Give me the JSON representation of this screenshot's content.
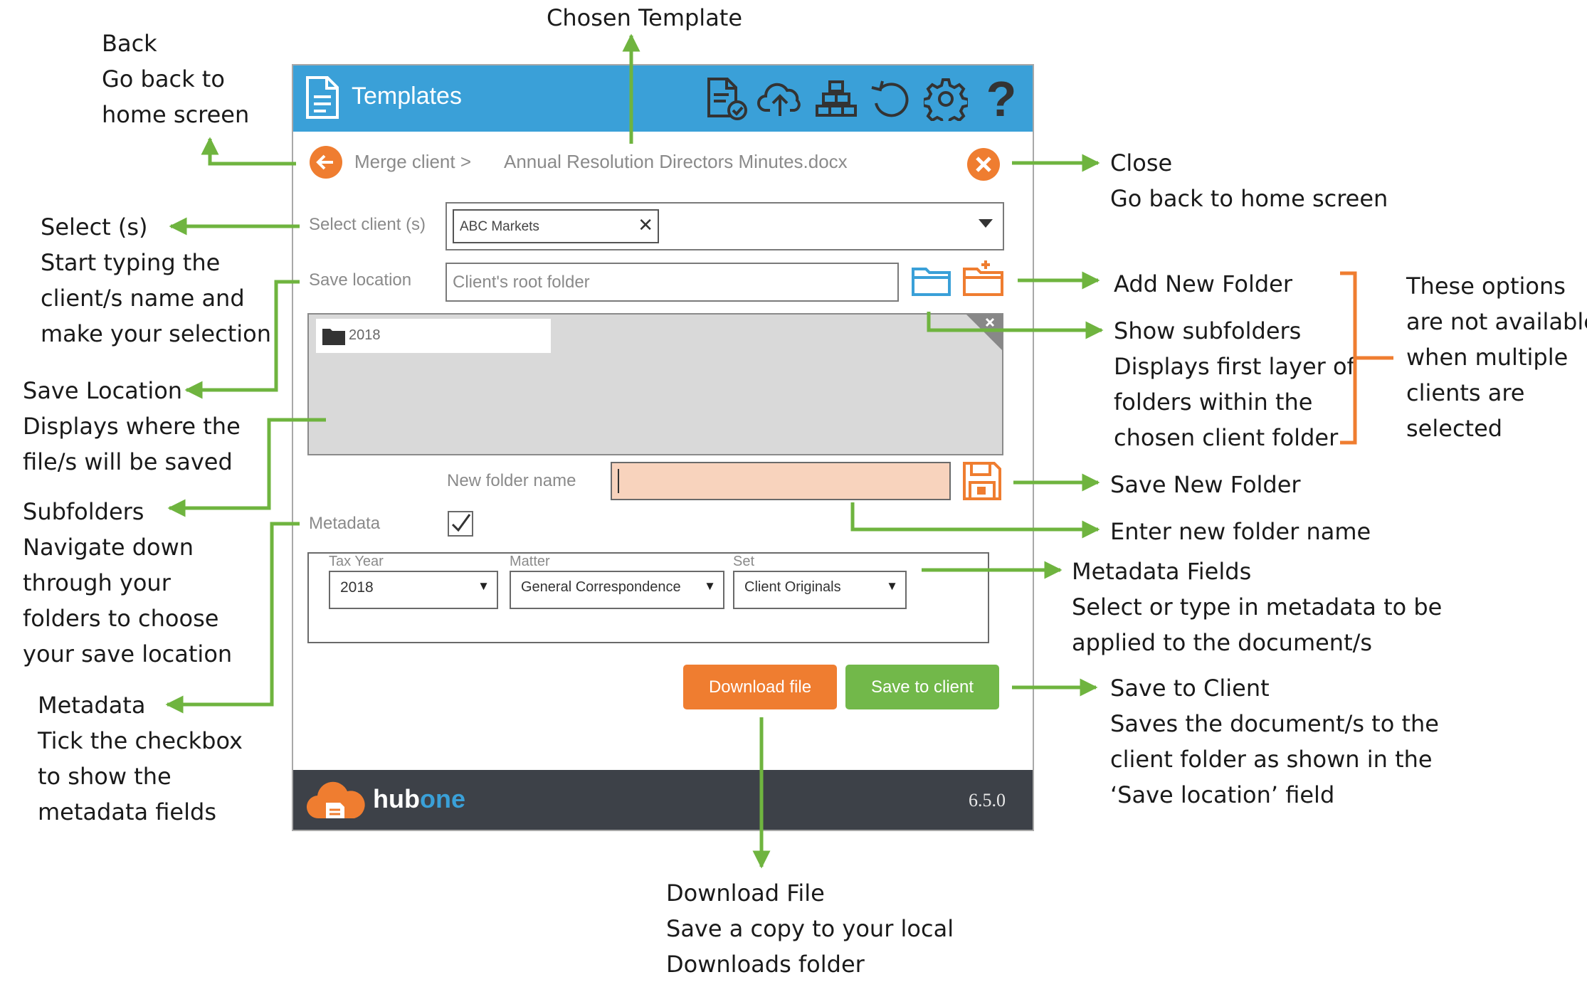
{
  "colors": {
    "accent_blue": "#3aa0d8",
    "orange": "#ef7d30",
    "green": "#72b84a",
    "arrow_green": "#6fb43f",
    "footer_dark": "#3d4148",
    "field_peach": "#f8d3bd",
    "folder_panel": "#d9d9d9"
  },
  "app": {
    "title": "Templates",
    "toolbar_icons": [
      "document-check-icon",
      "cloud-upload-icon",
      "hierarchy-icon",
      "refresh-icon",
      "gear-icon",
      "help-icon"
    ],
    "breadcrumb": {
      "parent": "Merge client >",
      "template": "Annual Resolution Directors Minutes.docx"
    },
    "select_client": {
      "label": "Select client (s)",
      "chip": "ABC Markets"
    },
    "save_location": {
      "label": "Save location",
      "value": "Client's root folder"
    },
    "subfolders": [
      "2018"
    ],
    "new_folder": {
      "label": "New folder name",
      "value": ""
    },
    "metadata": {
      "label": "Metadata",
      "checked": true,
      "fields": [
        {
          "label": "Tax Year",
          "value": "2018"
        },
        {
          "label": "Matter",
          "value": "General Correspondence"
        },
        {
          "label": "Set",
          "value": "Client Originals"
        }
      ]
    },
    "buttons": {
      "download": "Download file",
      "save": "Save to client"
    },
    "footer": {
      "brand_hub": "hub",
      "brand_one": "one",
      "version": "6.5.0"
    }
  },
  "annotations": {
    "chosen_template": "Chosen Template",
    "back": {
      "title": "Back",
      "lines": [
        "Go back to",
        "home screen"
      ]
    },
    "select": {
      "title": "Select (s)",
      "lines": [
        "Start typing the",
        "client/s name and",
        "make your selection"
      ]
    },
    "save_location": {
      "title": "Save Location",
      "lines": [
        "Displays where the",
        "file/s will be saved"
      ]
    },
    "subfolders": {
      "title": "Subfolders",
      "lines": [
        "Navigate down",
        "through your",
        "folders to choose",
        "your save location"
      ]
    },
    "metadata": {
      "title": "Metadata",
      "lines": [
        "Tick the checkbox",
        "to show the",
        "metadata fields"
      ]
    },
    "close": {
      "title": "Close",
      "lines": [
        "Go back to home screen"
      ]
    },
    "add_new_folder": {
      "title": "Add New Folder"
    },
    "show_subfolders": {
      "title": "Show subfolders",
      "lines": [
        "Displays first layer of",
        "folders within the",
        "chosen client folder"
      ]
    },
    "options_note": [
      "These options",
      "are not available",
      "when multiple",
      "clients are",
      "selected"
    ],
    "save_new_folder": {
      "title": "Save New Folder"
    },
    "enter_new_folder": {
      "title": "Enter new folder name"
    },
    "metadata_fields": {
      "title": "Metadata Fields",
      "lines": [
        "Select or type in metadata to be",
        "applied to the document/s"
      ]
    },
    "save_to_client": {
      "title": "Save to Client",
      "lines": [
        "Saves the document/s to the",
        "client folder as shown in the",
        "‘Save location’ field"
      ]
    },
    "download_file": {
      "title": "Download File",
      "lines": [
        "Save a copy to your local",
        "Downloads folder"
      ]
    }
  }
}
